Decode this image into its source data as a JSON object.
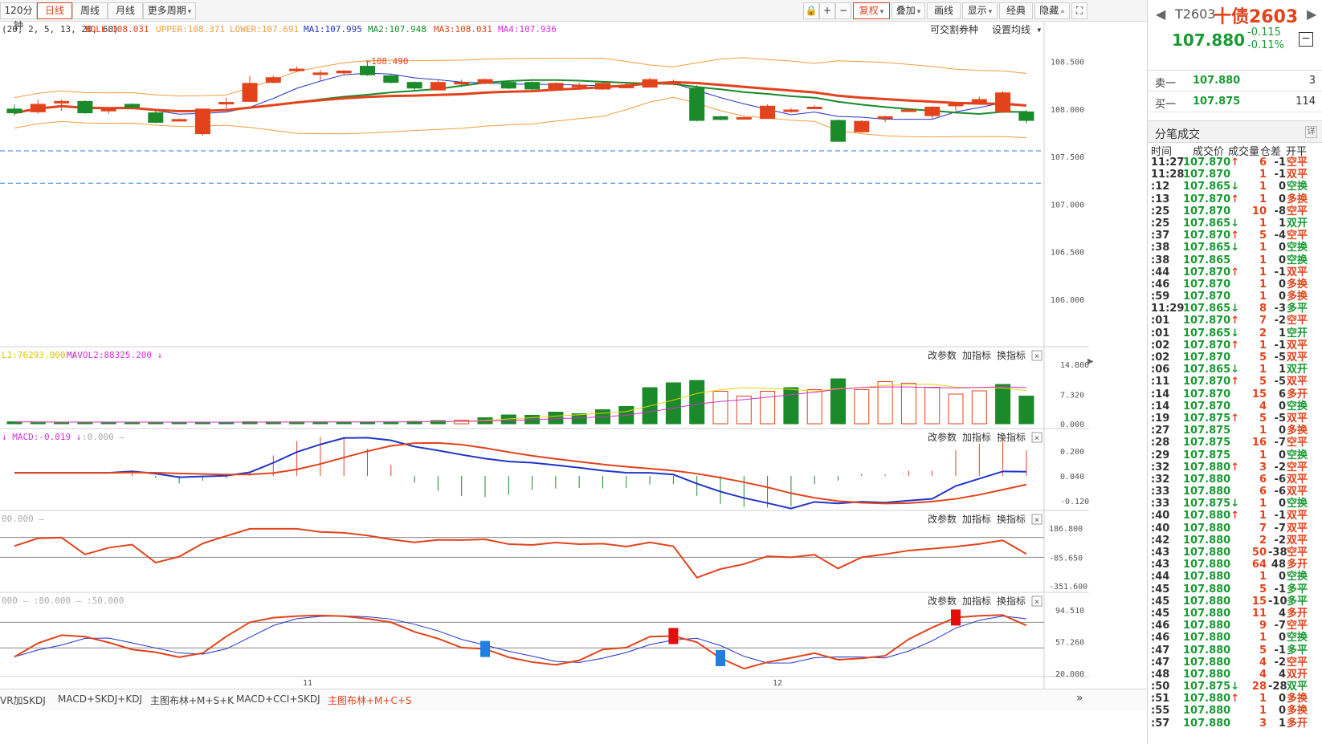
{
  "toolbar": {
    "periods": [
      "120分钟",
      "日线",
      "周线",
      "月线"
    ],
    "more_periods": "更多周期",
    "icons": [
      "lock-icon",
      "plus-icon",
      "minus-icon"
    ],
    "fq_label": "复权",
    "overlay": "叠加",
    "draw": "画线",
    "display": "显示",
    "classic": "经典",
    "hide": "隐藏",
    "fullscreen_icon": "fullscreen-icon"
  },
  "main_chart": {
    "boll_label": "(20, 2, 5, 13, 20, 60)",
    "boll": "BOLL:108.031",
    "upper": "UPPER:108.371",
    "lower": "LOWER:107.691",
    "ma1": "MA1:107.995",
    "ma2": "MA2:107.948",
    "ma3": "MA3:108.031",
    "ma4": "MA4:107.936",
    "right_links": [
      "可交割券种",
      "设置均线"
    ],
    "high_mark": "108.490",
    "y_ticks": [
      "108.500",
      "108.000",
      "107.500",
      "107.000",
      "106.500",
      "106.000"
    ],
    "x_labels": [
      "11",
      "12"
    ]
  },
  "indicators": {
    "actions": [
      "改参数",
      "加指标",
      "换指标"
    ],
    "vol": {
      "label1": "L1:76293.000",
      "label2": "MAVOL2:88325.200",
      "y_ticks": [
        "14.800",
        "7.320",
        "0.000"
      ]
    },
    "macd": {
      "label": "MACD:-0.019",
      "label2": ":0.000",
      "y_ticks": [
        "0.200",
        "0.040",
        "-0.120"
      ]
    },
    "cci": {
      "label": "00.000",
      "y_ticks": [
        "186.800",
        "-85.650",
        "-351.600"
      ]
    },
    "kdj": {
      "labels": [
        "000",
        ":80.000",
        ":50.000"
      ],
      "y_ticks": [
        "94.510",
        "57.260",
        "20.000"
      ]
    }
  },
  "bottom_tabs": [
    "VR加SKDJ",
    "MACD+SKDJ+KDJ",
    "主图布林+M+S+K",
    "MACD+CCI+SKDJ",
    "主图布林+M+C+S"
  ],
  "right_panel": {
    "code": "T2603",
    "name": "十债2603",
    "price": "107.880",
    "change": "-0.115",
    "change_pct": "-0.11%",
    "ask_label": "卖一",
    "ask_price": "107.880",
    "ask_vol": "3",
    "bid_label": "买一",
    "bid_price": "107.875",
    "bid_vol": "114",
    "ticks_title": "分笔成交",
    "ticks_more": "详",
    "tick_cols": [
      "时间",
      "成交价",
      "成交量",
      "仓差",
      "开平"
    ],
    "ticks": [
      {
        "t": "11:27",
        "p": "107.870",
        "a": "up",
        "v": "6",
        "oi": "-1",
        "ty": "空平",
        "tc": "red"
      },
      {
        "t": "11:28",
        "p": "107.870",
        "a": "",
        "v": "1",
        "oi": "-1",
        "ty": "双平",
        "tc": "red"
      },
      {
        "t": ":12",
        "p": "107.865",
        "a": "dn",
        "v": "1",
        "oi": "0",
        "ty": "空换",
        "tc": "green"
      },
      {
        "t": ":13",
        "p": "107.870",
        "a": "up",
        "v": "1",
        "oi": "0",
        "ty": "多换",
        "tc": "red"
      },
      {
        "t": ":25",
        "p": "107.870",
        "a": "",
        "v": "10",
        "oi": "-8",
        "ty": "空平",
        "tc": "red"
      },
      {
        "t": ":25",
        "p": "107.865",
        "a": "dn",
        "v": "1",
        "oi": "1",
        "ty": "双开",
        "tc": "green"
      },
      {
        "t": ":37",
        "p": "107.870",
        "a": "up",
        "v": "5",
        "oi": "-4",
        "ty": "空平",
        "tc": "red"
      },
      {
        "t": ":38",
        "p": "107.865",
        "a": "dn",
        "v": "1",
        "oi": "0",
        "ty": "空换",
        "tc": "green"
      },
      {
        "t": ":38",
        "p": "107.865",
        "a": "",
        "v": "1",
        "oi": "0",
        "ty": "空换",
        "tc": "green"
      },
      {
        "t": ":44",
        "p": "107.870",
        "a": "up",
        "v": "1",
        "oi": "-1",
        "ty": "双平",
        "tc": "red"
      },
      {
        "t": ":46",
        "p": "107.870",
        "a": "",
        "v": "1",
        "oi": "0",
        "ty": "多换",
        "tc": "red"
      },
      {
        "t": ":59",
        "p": "107.870",
        "a": "",
        "v": "1",
        "oi": "0",
        "ty": "多换",
        "tc": "red"
      },
      {
        "t": "11:29",
        "p": "107.865",
        "a": "dn",
        "v": "8",
        "oi": "-3",
        "ty": "多平",
        "tc": "green"
      },
      {
        "t": ":01",
        "p": "107.870",
        "a": "up",
        "v": "7",
        "oi": "-2",
        "ty": "空平",
        "tc": "red"
      },
      {
        "t": ":01",
        "p": "107.865",
        "a": "dn",
        "v": "2",
        "oi": "1",
        "ty": "空开",
        "tc": "green"
      },
      {
        "t": ":02",
        "p": "107.870",
        "a": "up",
        "v": "1",
        "oi": "-1",
        "ty": "双平",
        "tc": "red"
      },
      {
        "t": ":02",
        "p": "107.870",
        "a": "",
        "v": "5",
        "oi": "-5",
        "ty": "双平",
        "tc": "red"
      },
      {
        "t": ":06",
        "p": "107.865",
        "a": "dn",
        "v": "1",
        "oi": "1",
        "ty": "双开",
        "tc": "green"
      },
      {
        "t": ":11",
        "p": "107.870",
        "a": "up",
        "v": "5",
        "oi": "-5",
        "ty": "双平",
        "tc": "red"
      },
      {
        "t": ":14",
        "p": "107.870",
        "a": "",
        "v": "15",
        "oi": "6",
        "ty": "多开",
        "tc": "red"
      },
      {
        "t": ":14",
        "p": "107.870",
        "a": "",
        "v": "4",
        "oi": "0",
        "ty": "空换",
        "tc": "green"
      },
      {
        "t": ":19",
        "p": "107.875",
        "a": "up",
        "v": "5",
        "oi": "-5",
        "ty": "双平",
        "tc": "red"
      },
      {
        "t": ":27",
        "p": "107.875",
        "a": "",
        "v": "1",
        "oi": "0",
        "ty": "多换",
        "tc": "red"
      },
      {
        "t": ":28",
        "p": "107.875",
        "a": "",
        "v": "16",
        "oi": "-7",
        "ty": "空平",
        "tc": "red"
      },
      {
        "t": ":29",
        "p": "107.875",
        "a": "",
        "v": "1",
        "oi": "0",
        "ty": "空换",
        "tc": "green"
      },
      {
        "t": ":32",
        "p": "107.880",
        "a": "up",
        "v": "3",
        "oi": "-2",
        "ty": "空平",
        "tc": "red"
      },
      {
        "t": ":32",
        "p": "107.880",
        "a": "",
        "v": "6",
        "oi": "-6",
        "ty": "双平",
        "tc": "red"
      },
      {
        "t": ":33",
        "p": "107.880",
        "a": "",
        "v": "6",
        "oi": "-6",
        "ty": "双平",
        "tc": "red"
      },
      {
        "t": ":33",
        "p": "107.875",
        "a": "dn",
        "v": "1",
        "oi": "0",
        "ty": "空换",
        "tc": "green"
      },
      {
        "t": ":40",
        "p": "107.880",
        "a": "up",
        "v": "1",
        "oi": "-1",
        "ty": "双平",
        "tc": "red"
      },
      {
        "t": ":40",
        "p": "107.880",
        "a": "",
        "v": "7",
        "oi": "-7",
        "ty": "双平",
        "tc": "red"
      },
      {
        "t": ":42",
        "p": "107.880",
        "a": "",
        "v": "2",
        "oi": "-2",
        "ty": "双平",
        "tc": "red"
      },
      {
        "t": ":43",
        "p": "107.880",
        "a": "",
        "v": "50",
        "oi": "-38",
        "ty": "空平",
        "tc": "red"
      },
      {
        "t": ":43",
        "p": "107.880",
        "a": "",
        "v": "64",
        "oi": "48",
        "ty": "多开",
        "tc": "red"
      },
      {
        "t": ":44",
        "p": "107.880",
        "a": "",
        "v": "1",
        "oi": "0",
        "ty": "空换",
        "tc": "green"
      },
      {
        "t": ":45",
        "p": "107.880",
        "a": "",
        "v": "5",
        "oi": "-1",
        "ty": "多平",
        "tc": "green"
      },
      {
        "t": ":45",
        "p": "107.880",
        "a": "",
        "v": "15",
        "oi": "-10",
        "ty": "多平",
        "tc": "green"
      },
      {
        "t": ":45",
        "p": "107.880",
        "a": "",
        "v": "11",
        "oi": "4",
        "ty": "多开",
        "tc": "red"
      },
      {
        "t": ":46",
        "p": "107.880",
        "a": "",
        "v": "9",
        "oi": "-7",
        "ty": "空平",
        "tc": "red"
      },
      {
        "t": ":46",
        "p": "107.880",
        "a": "",
        "v": "1",
        "oi": "0",
        "ty": "空换",
        "tc": "green"
      },
      {
        "t": ":47",
        "p": "107.880",
        "a": "",
        "v": "5",
        "oi": "-1",
        "ty": "多平",
        "tc": "green"
      },
      {
        "t": ":47",
        "p": "107.880",
        "a": "",
        "v": "4",
        "oi": "-2",
        "ty": "空平",
        "tc": "red"
      },
      {
        "t": ":48",
        "p": "107.880",
        "a": "",
        "v": "4",
        "oi": "4",
        "ty": "双开",
        "tc": "red"
      },
      {
        "t": ":50",
        "p": "107.875",
        "a": "dn",
        "v": "28",
        "oi": "-28",
        "ty": "双平",
        "tc": "green"
      },
      {
        "t": ":51",
        "p": "107.880",
        "a": "up",
        "v": "1",
        "oi": "0",
        "ty": "多换",
        "tc": "red"
      },
      {
        "t": ":55",
        "p": "107.880",
        "a": "",
        "v": "1",
        "oi": "0",
        "ty": "多换",
        "tc": "red"
      },
      {
        "t": ":57",
        "p": "107.880",
        "a": "",
        "v": "3",
        "oi": "1",
        "ty": "多开",
        "tc": "red"
      }
    ]
  },
  "chart_data": {
    "type": "candlestick",
    "y_axis": {
      "min": 105.5,
      "max": 108.75
    },
    "candles": [
      {
        "o": 108.0,
        "c": 107.96,
        "h": 108.05,
        "l": 107.93
      },
      {
        "o": 107.97,
        "c": 108.05,
        "h": 108.1,
        "l": 107.95
      },
      {
        "o": 108.08,
        "c": 108.08,
        "h": 108.1,
        "l": 107.98
      },
      {
        "o": 108.08,
        "c": 107.96,
        "h": 108.09,
        "l": 107.95
      },
      {
        "o": 107.98,
        "c": 108.0,
        "h": 108.01,
        "l": 107.95
      },
      {
        "o": 108.05,
        "c": 108.02,
        "h": 108.06,
        "l": 108.0
      },
      {
        "o": 107.96,
        "c": 107.86,
        "h": 107.98,
        "l": 107.85
      },
      {
        "o": 107.89,
        "c": 107.89,
        "h": 107.9,
        "l": 107.87
      },
      {
        "o": 107.74,
        "c": 108.0,
        "h": 108.0,
        "l": 107.72
      },
      {
        "o": 108.07,
        "c": 108.07,
        "h": 108.12,
        "l": 108.0
      },
      {
        "o": 108.08,
        "c": 108.27,
        "h": 108.35,
        "l": 108.08
      },
      {
        "o": 108.28,
        "c": 108.33,
        "h": 108.35,
        "l": 108.27
      },
      {
        "o": 108.41,
        "c": 108.42,
        "h": 108.45,
        "l": 108.39
      },
      {
        "o": 108.38,
        "c": 108.38,
        "h": 108.41,
        "l": 108.3
      },
      {
        "o": 108.38,
        "c": 108.4,
        "h": 108.41,
        "l": 108.36
      },
      {
        "o": 108.45,
        "c": 108.36,
        "h": 108.49,
        "l": 108.35
      },
      {
        "o": 108.35,
        "c": 108.28,
        "h": 108.37,
        "l": 108.27
      },
      {
        "o": 108.28,
        "c": 108.22,
        "h": 108.29,
        "l": 108.2
      },
      {
        "o": 108.2,
        "c": 108.28,
        "h": 108.3,
        "l": 108.2
      },
      {
        "o": 108.28,
        "c": 108.28,
        "h": 108.31,
        "l": 108.25
      },
      {
        "o": 108.27,
        "c": 108.31,
        "h": 108.32,
        "l": 108.26
      },
      {
        "o": 108.28,
        "c": 108.22,
        "h": 108.3,
        "l": 108.21
      },
      {
        "o": 108.28,
        "c": 108.21,
        "h": 108.29,
        "l": 108.2
      },
      {
        "o": 108.21,
        "c": 108.27,
        "h": 108.28,
        "l": 108.2
      },
      {
        "o": 108.25,
        "c": 108.25,
        "h": 108.28,
        "l": 108.2
      },
      {
        "o": 108.21,
        "c": 108.27,
        "h": 108.28,
        "l": 108.2
      },
      {
        "o": 108.24,
        "c": 108.24,
        "h": 108.27,
        "l": 108.22
      },
      {
        "o": 108.23,
        "c": 108.31,
        "h": 108.33,
        "l": 108.23
      },
      {
        "o": 108.28,
        "c": 108.28,
        "h": 108.31,
        "l": 108.25
      },
      {
        "o": 108.22,
        "c": 107.88,
        "h": 108.25,
        "l": 107.87
      },
      {
        "o": 107.92,
        "c": 107.89,
        "h": 107.93,
        "l": 107.88
      },
      {
        "o": 107.91,
        "c": 107.91,
        "h": 107.92,
        "l": 107.89
      },
      {
        "o": 107.9,
        "c": 108.03,
        "h": 108.05,
        "l": 107.9
      },
      {
        "o": 107.99,
        "c": 107.99,
        "h": 108.01,
        "l": 107.96
      },
      {
        "o": 108.02,
        "c": 108.02,
        "h": 108.04,
        "l": 108.01
      },
      {
        "o": 107.88,
        "c": 107.66,
        "h": 107.89,
        "l": 107.65
      },
      {
        "o": 107.76,
        "c": 107.87,
        "h": 107.88,
        "l": 107.75
      },
      {
        "o": 107.9,
        "c": 107.92,
        "h": 107.93,
        "l": 107.86
      },
      {
        "o": 107.99,
        "c": 107.99,
        "h": 108.01,
        "l": 107.97
      },
      {
        "o": 107.93,
        "c": 108.02,
        "h": 108.03,
        "l": 107.9
      },
      {
        "o": 108.05,
        "c": 108.05,
        "h": 108.07,
        "l": 107.98
      },
      {
        "o": 108.06,
        "c": 108.1,
        "h": 108.13,
        "l": 108.05
      },
      {
        "o": 107.97,
        "c": 108.17,
        "h": 108.19,
        "l": 107.96
      },
      {
        "o": 107.97,
        "c": 107.88,
        "h": 107.99,
        "l": 107.85
      }
    ],
    "volume": [
      0.5,
      0.4,
      0.4,
      0.4,
      0.4,
      0.4,
      0.4,
      0.4,
      0.4,
      0.4,
      0.5,
      0.5,
      0.5,
      0.5,
      0.5,
      0.5,
      0.5,
      0.6,
      0.8,
      0.9,
      1.5,
      2.2,
      2.1,
      2.9,
      2.5,
      3.5,
      4.3,
      9.0,
      10.2,
      10.8,
      8.1,
      6.9,
      8.1,
      9.0,
      8.5,
      11.2,
      8.5,
      10.5,
      10.1,
      9.1,
      7.4,
      8.2,
      9.8,
      6.9
    ],
    "vol_colors": [
      "g",
      "g",
      "g",
      "g",
      "g",
      "g",
      "g",
      "g",
      "g",
      "g",
      "g",
      "g",
      "g",
      "g",
      "g",
      "g",
      "g",
      "g",
      "g",
      "r",
      "g",
      "g",
      "g",
      "g",
      "g",
      "g",
      "g",
      "g",
      "g",
      "g",
      "r",
      "r",
      "r",
      "g",
      "r",
      "g",
      "r",
      "r",
      "r",
      "r",
      "r",
      "r",
      "g",
      "g"
    ]
  }
}
